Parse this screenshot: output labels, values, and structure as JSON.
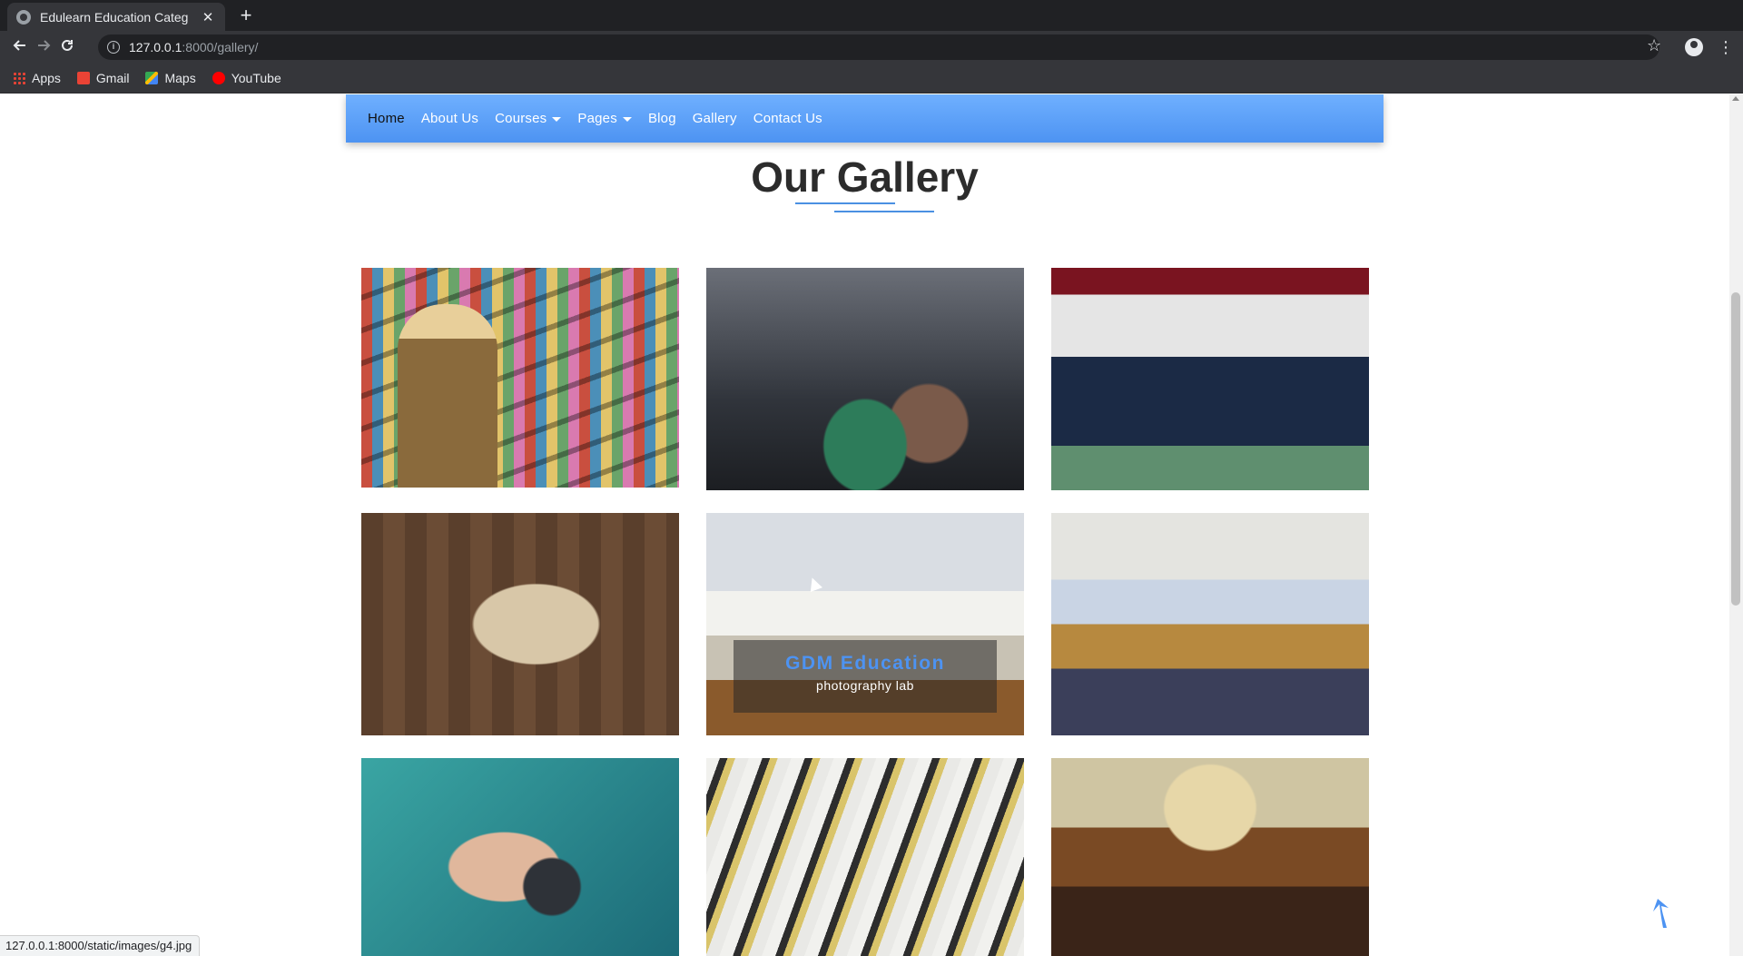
{
  "browser": {
    "tab_title": "Edulearn Education Categ",
    "url_host": "127.0.0.1",
    "url_path": ":8000/gallery/",
    "bookmarks": [
      "Apps",
      "Gmail",
      "Maps",
      "YouTube"
    ],
    "status_url": "127.0.0.1:8000/static/images/g4.jpg"
  },
  "nav": {
    "items": [
      "Home",
      "About Us",
      "Courses",
      "Pages",
      "Blog",
      "Gallery",
      "Contact Us"
    ],
    "active": "Home"
  },
  "heading": {
    "light": "Our",
    "bold": "Gallery"
  },
  "gallery": {
    "hover_title": "GDM Education",
    "hover_subtitle": "photography lab"
  },
  "colors": {
    "accent": "#4d93f2",
    "nav_gradient_top": "#6fb0ff",
    "nav_gradient_bottom": "#4d93f2",
    "heading_text": "#2c2c2c"
  },
  "icons": {
    "back": "arrow-left-icon",
    "forward": "arrow-right-icon",
    "reload": "reload-icon",
    "bookmark": "star-icon",
    "scroll_top": "arrow-up-icon"
  }
}
